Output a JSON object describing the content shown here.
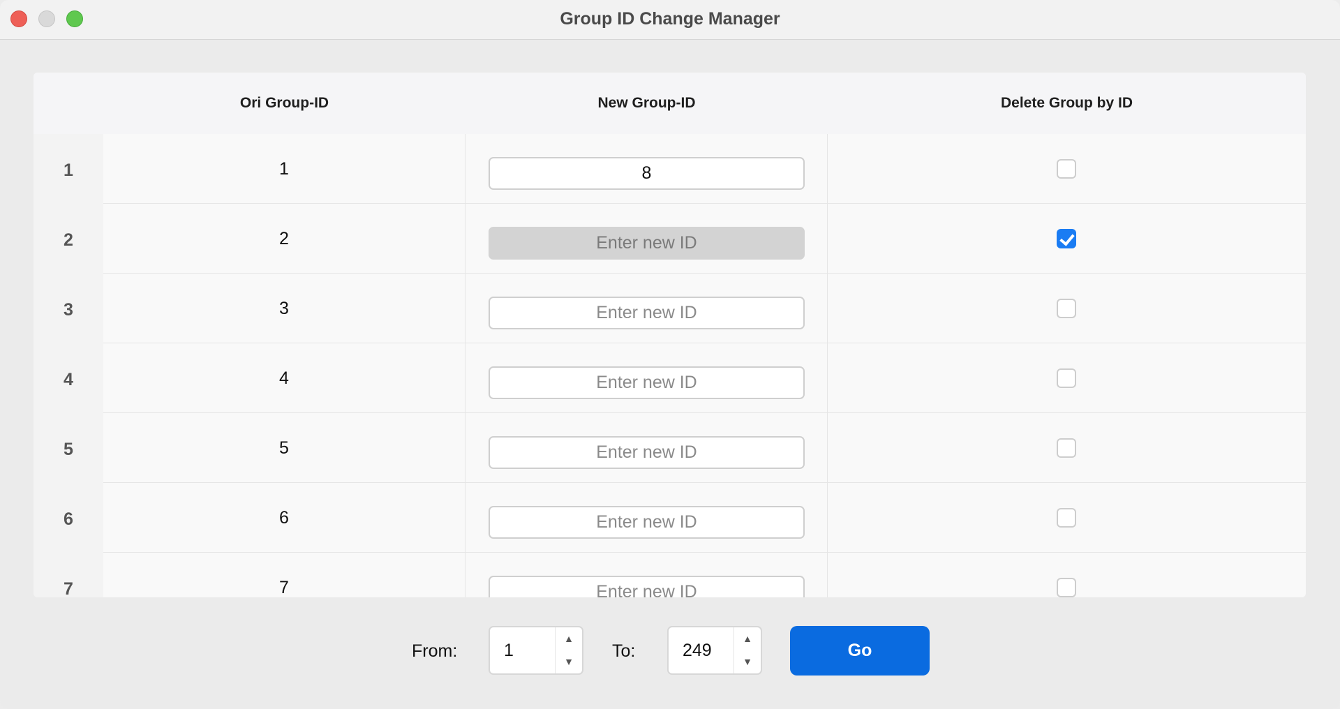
{
  "window": {
    "title": "Group ID Change Manager"
  },
  "table": {
    "headers": [
      "Ori Group-ID",
      "New Group-ID",
      "Delete Group by ID"
    ],
    "rows": [
      {
        "num": "1",
        "orig": "1",
        "new_value": "8",
        "placeholder": "Enter new ID",
        "deleted": false
      },
      {
        "num": "2",
        "orig": "2",
        "new_value": "",
        "placeholder": "Enter new ID",
        "deleted": true
      },
      {
        "num": "3",
        "orig": "3",
        "new_value": "",
        "placeholder": "Enter new ID",
        "deleted": false
      },
      {
        "num": "4",
        "orig": "4",
        "new_value": "",
        "placeholder": "Enter new ID",
        "deleted": false
      },
      {
        "num": "5",
        "orig": "5",
        "new_value": "",
        "placeholder": "Enter new ID",
        "deleted": false
      },
      {
        "num": "6",
        "orig": "6",
        "new_value": "",
        "placeholder": "Enter new ID",
        "deleted": false
      },
      {
        "num": "7",
        "orig": "7",
        "new_value": "",
        "placeholder": "Enter new ID",
        "deleted": false
      }
    ]
  },
  "footer": {
    "from_label": "From:",
    "from_value": "1",
    "to_label": "To:",
    "to_value": "249",
    "go_label": "Go"
  },
  "colors": {
    "accent": "#0a6be0",
    "checkbox_checked": "#1a7cf3",
    "disabled_input": "#d3d3d3"
  }
}
